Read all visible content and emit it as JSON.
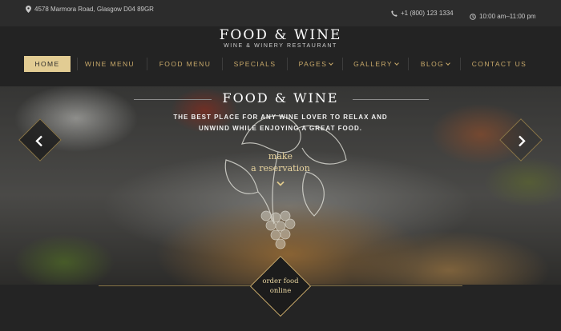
{
  "topbar": {
    "address": "4578 Marmora Road, Glasgow D04 89GR",
    "phone": "+1 (800) 123 1334",
    "hours": "10:00 am–11:00 pm"
  },
  "brand": {
    "title": "FOOD & WINE",
    "subtitle": "WINE & WINERY RESTAURANT"
  },
  "nav": {
    "items": [
      {
        "label": "HOME",
        "active": true
      },
      {
        "label": "WINE MENU"
      },
      {
        "label": "FOOD MENU"
      },
      {
        "label": "SPECIALS"
      },
      {
        "label": "PAGES",
        "dropdown": true
      },
      {
        "label": "GALLERY",
        "dropdown": true
      },
      {
        "label": "BLOG",
        "dropdown": true
      },
      {
        "label": "CONTACT US"
      }
    ]
  },
  "hero": {
    "title": "FOOD & WINE",
    "tagline_1": "THE BEST PLACE FOR ANY WINE LOVER TO RELAX AND",
    "tagline_2": "UNWIND WHILE ENJOYING A GREAT FOOD.",
    "reservation_1": "make",
    "reservation_2": "a reservation"
  },
  "order": {
    "line_1": "order food",
    "line_2": "online"
  },
  "colors": {
    "accent": "#c8a96a",
    "active_nav_bg": "#e2cc93",
    "header_bg": "#232323",
    "topbar_bg": "#2c2c2c"
  },
  "icons": [
    "location-pin-icon",
    "phone-icon",
    "clock-icon",
    "chevron-left-icon",
    "chevron-right-icon",
    "chevron-down-icon"
  ]
}
